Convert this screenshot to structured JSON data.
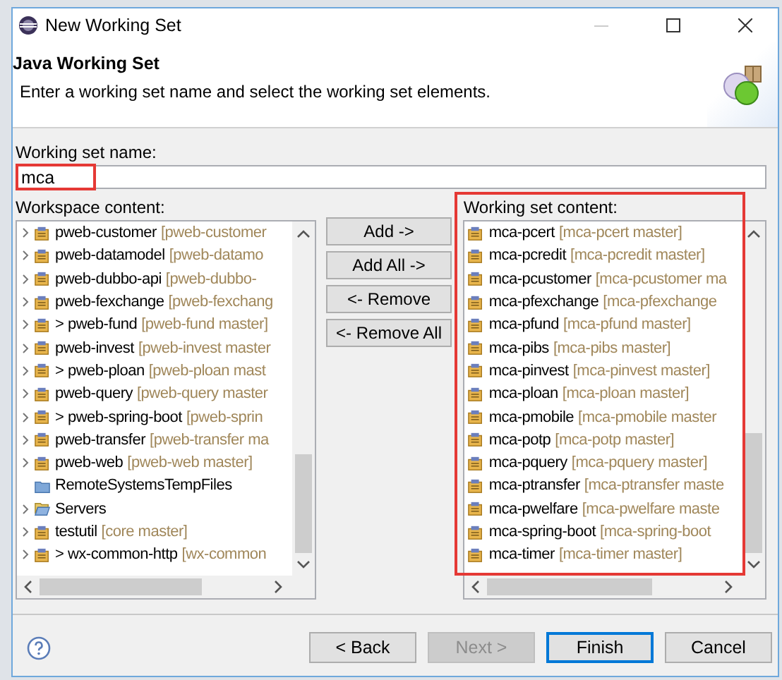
{
  "window": {
    "title": "New Working Set"
  },
  "header": {
    "title": "Java Working Set",
    "description": "Enter a working set name and select the working set elements."
  },
  "name_field": {
    "label": "Working set name:",
    "value": "mca",
    "highlighted": true
  },
  "workspace": {
    "label": "Workspace content:",
    "items": [
      {
        "kind": "project",
        "expandable": true,
        "name": "pweb-customer",
        "detail": "[pweb-customer"
      },
      {
        "kind": "project",
        "expandable": true,
        "name": "pweb-datamodel",
        "detail": "[pweb-datamo"
      },
      {
        "kind": "project",
        "expandable": true,
        "name": "pweb-dubbo-api",
        "detail": "[pweb-dubbo-"
      },
      {
        "kind": "project",
        "expandable": true,
        "name": "pweb-fexchange",
        "detail": "[pweb-fexchang"
      },
      {
        "kind": "project",
        "expandable": true,
        "name": "> pweb-fund",
        "detail": "[pweb-fund master]"
      },
      {
        "kind": "project",
        "expandable": true,
        "name": "pweb-invest",
        "detail": "[pweb-invest master"
      },
      {
        "kind": "project",
        "expandable": true,
        "name": "> pweb-ploan",
        "detail": "[pweb-ploan mast"
      },
      {
        "kind": "project",
        "expandable": true,
        "name": "pweb-query",
        "detail": "[pweb-query master"
      },
      {
        "kind": "project",
        "expandable": true,
        "name": "> pweb-spring-boot",
        "detail": "[pweb-sprin"
      },
      {
        "kind": "project",
        "expandable": true,
        "name": "pweb-transfer",
        "detail": "[pweb-transfer ma"
      },
      {
        "kind": "project",
        "expandable": true,
        "name": "pweb-web",
        "detail": "[pweb-web master]"
      },
      {
        "kind": "folder",
        "expandable": false,
        "name": "RemoteSystemsTempFiles"
      },
      {
        "kind": "open-folder",
        "expandable": true,
        "name": "Servers"
      },
      {
        "kind": "project",
        "expandable": true,
        "name": "testutil",
        "detail": "[core master]"
      },
      {
        "kind": "project",
        "expandable": true,
        "name": "> wx-common-http",
        "detail": "[wx-common"
      }
    ]
  },
  "transfer_buttons": [
    {
      "label": "Add ->"
    },
    {
      "label": "Add All ->"
    },
    {
      "label": "<- Remove"
    },
    {
      "label": "<- Remove All"
    }
  ],
  "content": {
    "label": "Working set content:",
    "highlighted": true,
    "items": [
      {
        "kind": "project",
        "name": "mca-pcert",
        "detail": "[mca-pcert master]"
      },
      {
        "kind": "project",
        "name": "mca-pcredit",
        "detail": "[mca-pcredit master]"
      },
      {
        "kind": "project",
        "name": "mca-pcustomer",
        "detail": "[mca-pcustomer ma"
      },
      {
        "kind": "project",
        "name": "mca-pfexchange",
        "detail": "[mca-pfexchange"
      },
      {
        "kind": "project",
        "name": "mca-pfund",
        "detail": "[mca-pfund master]"
      },
      {
        "kind": "project",
        "name": "mca-pibs",
        "detail": "[mca-pibs master]"
      },
      {
        "kind": "project",
        "name": "mca-pinvest",
        "detail": "[mca-pinvest master]"
      },
      {
        "kind": "project",
        "name": "mca-ploan",
        "detail": "[mca-ploan master]"
      },
      {
        "kind": "project",
        "name": "mca-pmobile",
        "detail": "[mca-pmobile master"
      },
      {
        "kind": "project",
        "name": "mca-potp",
        "detail": "[mca-potp master]"
      },
      {
        "kind": "project",
        "name": "mca-pquery",
        "detail": "[mca-pquery master]"
      },
      {
        "kind": "project",
        "name": "mca-ptransfer",
        "detail": "[mca-ptransfer maste"
      },
      {
        "kind": "project",
        "name": "mca-pwelfare",
        "detail": "[mca-pwelfare maste"
      },
      {
        "kind": "project",
        "name": "mca-spring-boot",
        "detail": "[mca-spring-boot"
      },
      {
        "kind": "project",
        "name": "mca-timer",
        "detail": "[mca-timer master]"
      }
    ]
  },
  "footer_buttons": [
    {
      "label": "< Back",
      "disabled": false,
      "default": false
    },
    {
      "label": "Next >",
      "disabled": true,
      "default": false
    },
    {
      "label": "Finish",
      "disabled": false,
      "default": true
    },
    {
      "label": "Cancel",
      "disabled": false,
      "default": false
    }
  ]
}
